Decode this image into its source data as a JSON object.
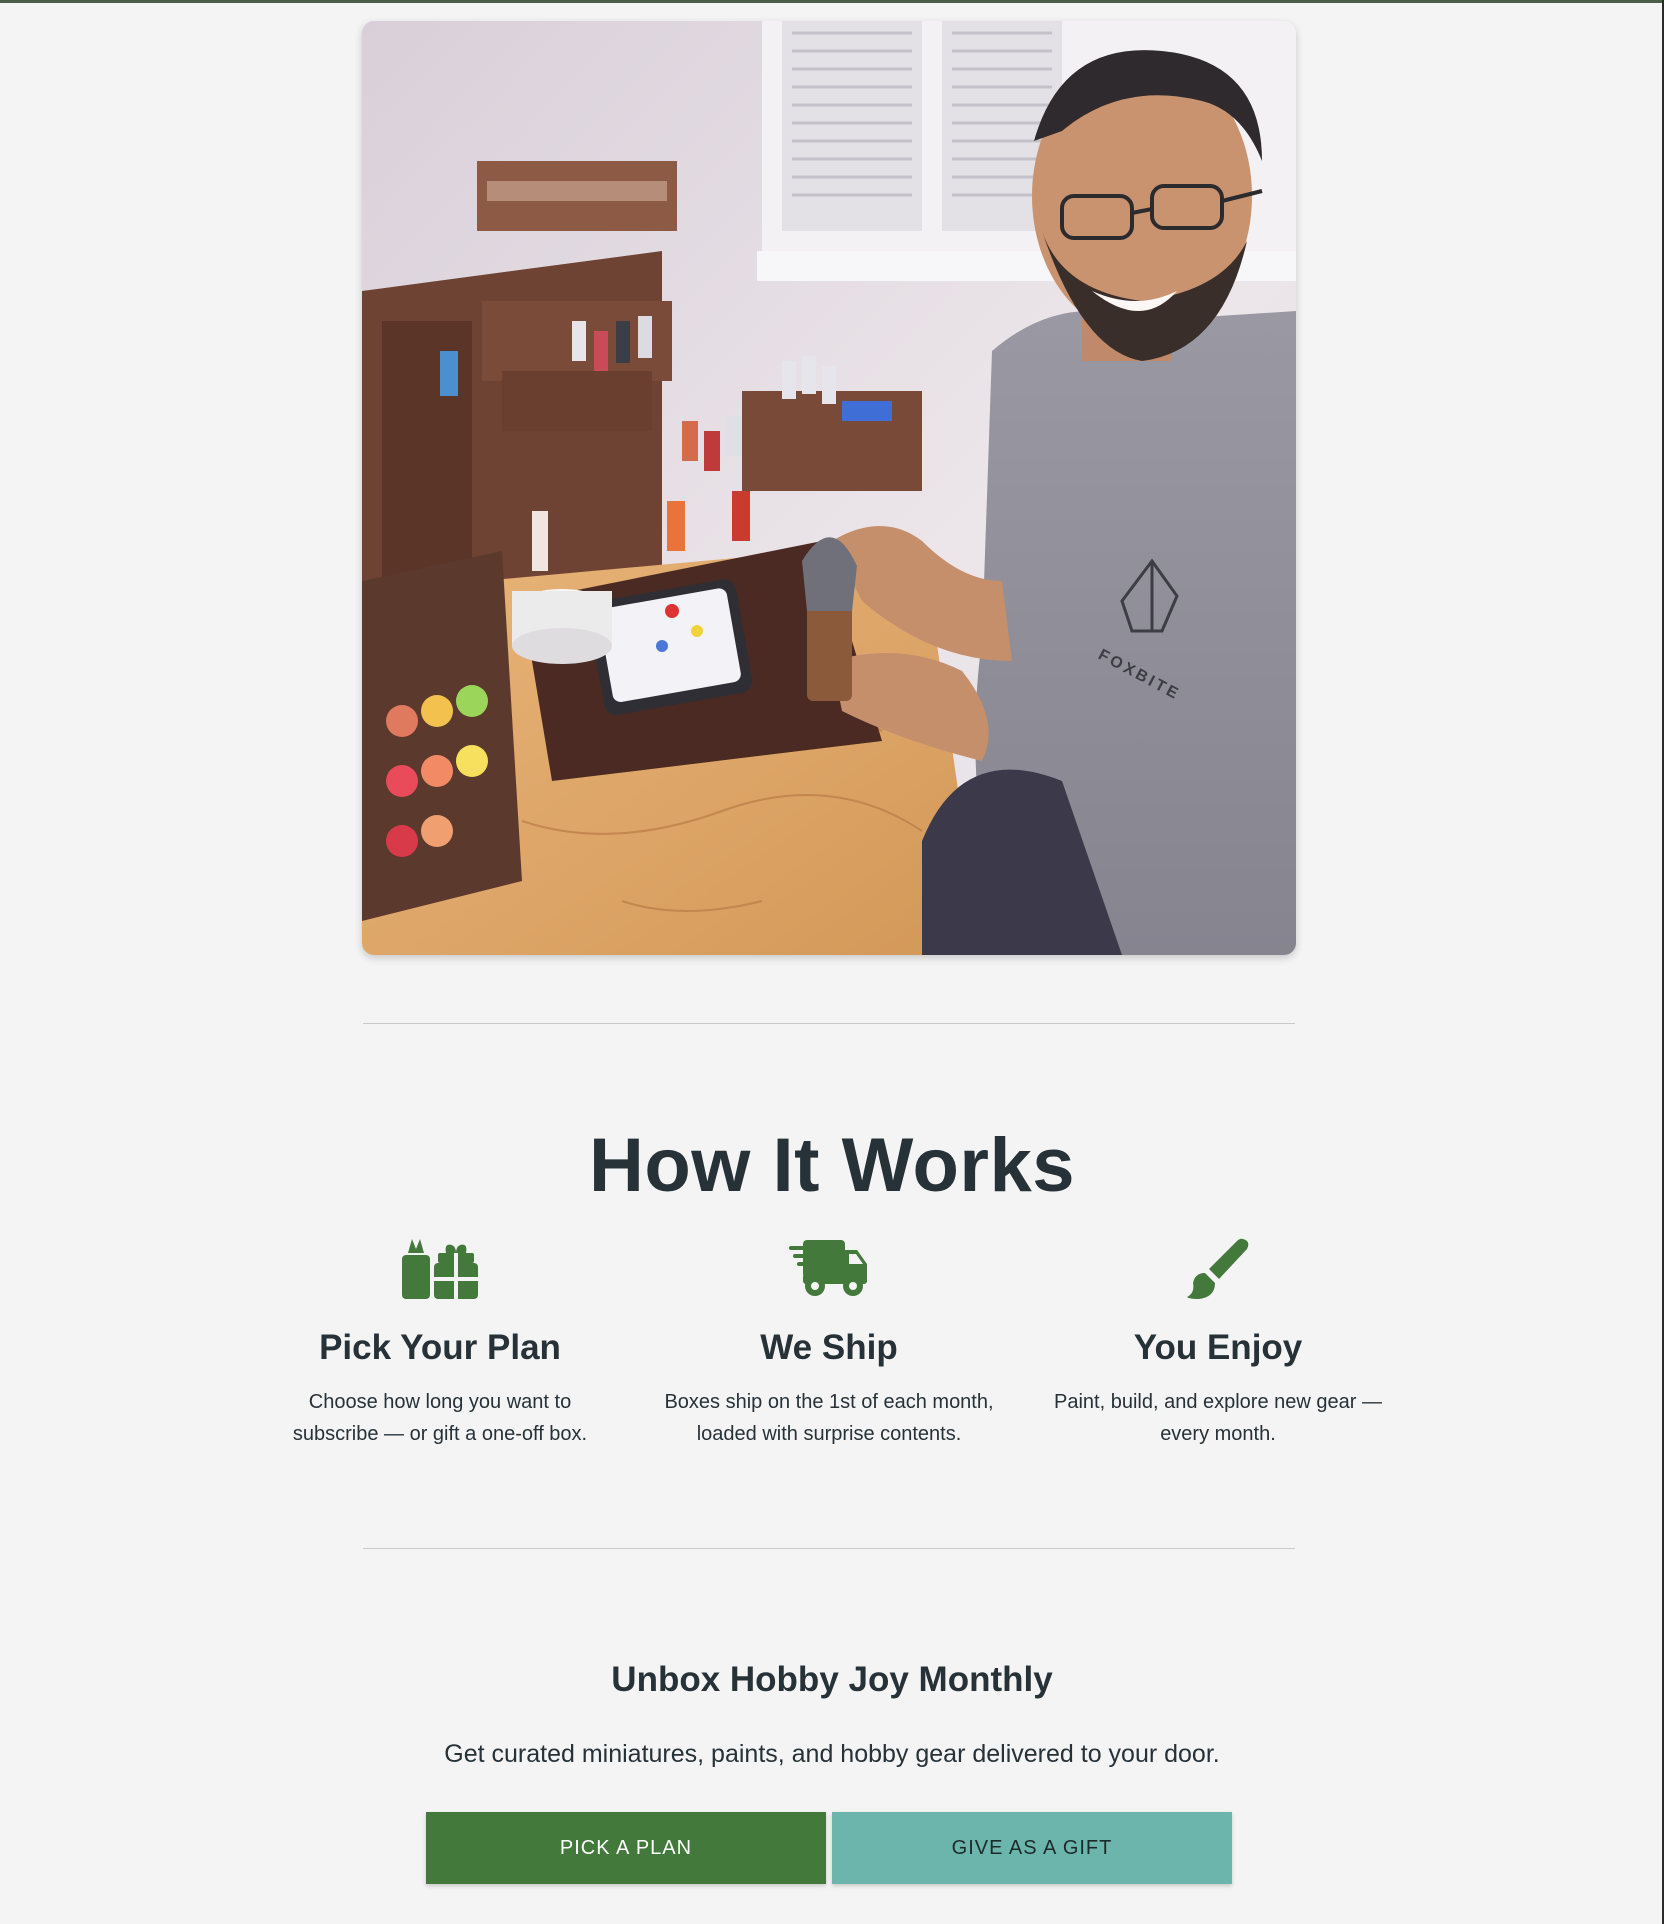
{
  "hero": {
    "image_alt": "Hobbyist painting a miniature at a wooden desk with paint racks",
    "shirt_brand": "FOXBITE"
  },
  "how_it_works": {
    "title": "How It Works",
    "steps": [
      {
        "icon": "gift-icon",
        "title": "Pick Your Plan",
        "text_line1": "Choose how long you want to",
        "text_line2": "subscribe — or gift a one-off box."
      },
      {
        "icon": "truck-icon",
        "title": "We Ship",
        "text_line1": "Boxes ship on the 1st of each month,",
        "text_line2": "loaded with surprise contents."
      },
      {
        "icon": "paintbrush-icon",
        "title": "You Enjoy",
        "text_line1": "Paint, build, and explore new gear —",
        "text_line2": "every month."
      }
    ]
  },
  "cta": {
    "title": "Unbox Hobby Joy Monthly",
    "text": "Get curated miniatures, paints, and hobby gear delivered to your door.",
    "primary_label": "PICK A PLAN",
    "secondary_label": "GIVE AS A GIFT"
  },
  "colors": {
    "accent_green": "#437a3c",
    "accent_teal": "#6cb5ad",
    "text_dark": "#263238",
    "background": "#f4f4f4"
  }
}
